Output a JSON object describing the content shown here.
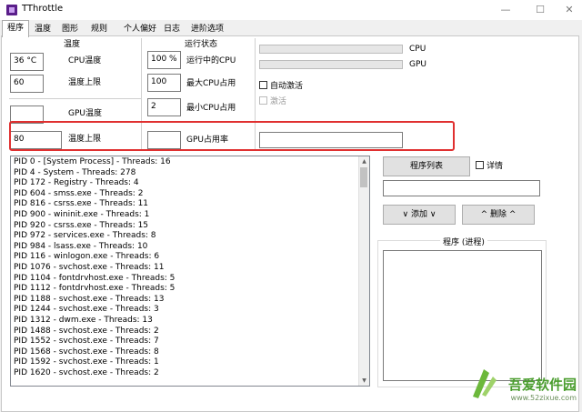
{
  "window": {
    "title": "TThrottle",
    "min_glyph": "—",
    "max_glyph": "☐",
    "close_glyph": "✕"
  },
  "tabs": [
    "程序",
    "温度",
    "图形",
    "规则",
    "个人偏好",
    "日志",
    "进阶选项"
  ],
  "cpu_section": {
    "header": "温度",
    "temp_value": "36 °C",
    "temp_label": "CPU温度",
    "limit_value": "60",
    "limit_label": "温度上限"
  },
  "status_section": {
    "header": "运行状态",
    "running_value": "100 %",
    "running_label": "运行中的CPU",
    "max_value": "100",
    "max_label": "最大CPU占用",
    "min_value": "2",
    "min_label": "最小CPU占用"
  },
  "bars": {
    "cpu_label": "CPU",
    "gpu_label": "GPU"
  },
  "checks": {
    "auto_activate": "自动激活",
    "activate": "激活"
  },
  "gpu_section": {
    "temp_label": "GPU温度",
    "temp_value": "",
    "limit_value": "80",
    "limit_label": "温度上限",
    "usage_value": "",
    "usage_label": "GPU占用率"
  },
  "process_list": [
    "PID 0 - [System Process] - Threads: 16",
    "PID 4 - System - Threads: 278",
    "PID 172 - Registry - Threads: 4",
    "PID 604 - smss.exe - Threads: 2",
    "PID 816 - csrss.exe - Threads: 11",
    "PID 900 - wininit.exe - Threads: 1",
    "PID 920 - csrss.exe - Threads: 15",
    "PID 972 - services.exe - Threads: 8",
    "PID 984 - lsass.exe - Threads: 10",
    "PID 116 - winlogon.exe - Threads: 6",
    "PID 1076 - svchost.exe - Threads: 11",
    "PID 1104 - fontdrvhost.exe - Threads: 5",
    "PID 1112 - fontdrvhost.exe - Threads: 5",
    "PID 1188 - svchost.exe - Threads: 13",
    "PID 1244 - svchost.exe - Threads: 3",
    "PID 1312 - dwm.exe - Threads: 13",
    "PID 1488 - svchost.exe - Threads: 2",
    "PID 1552 - svchost.exe - Threads: 7",
    "PID 1568 - svchost.exe - Threads: 8",
    "PID 1592 - svchost.exe - Threads: 1",
    "PID 1620 - svchost.exe - Threads: 2"
  ],
  "right_panel": {
    "program_list_button": "程序列表",
    "details_label": "详情",
    "filter_value": "",
    "add_button": "∨ 添加 ∨",
    "remove_button": "^ 删除 ^",
    "group_title": "程序 (进程)"
  },
  "watermark": {
    "brand": "吾爱软件园",
    "url": "www.52zixue.com"
  }
}
